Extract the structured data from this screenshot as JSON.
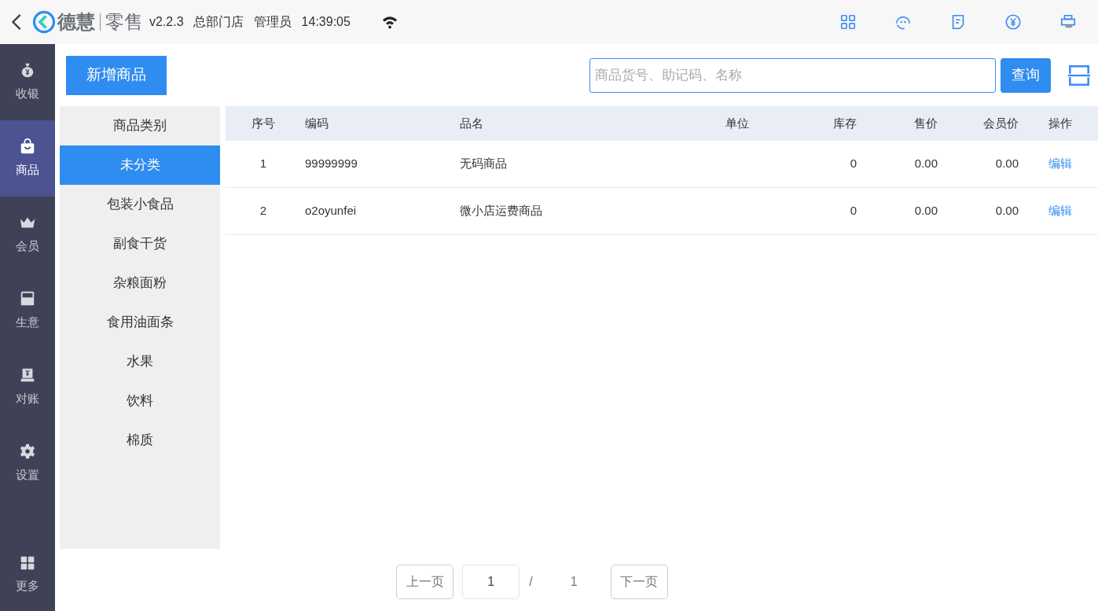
{
  "top_bar": {
    "brand": [
      "德慧",
      "零售"
    ],
    "version": "v2.2.3",
    "store": "总部门店",
    "user": "管理员",
    "time": "14:39:05"
  },
  "sidebar": {
    "items": [
      {
        "label": "收银",
        "selected": false
      },
      {
        "label": "商品",
        "selected": true
      },
      {
        "label": "会员",
        "selected": false
      },
      {
        "label": "生意",
        "selected": false
      },
      {
        "label": "对账",
        "selected": false
      },
      {
        "label": "设置",
        "selected": false
      }
    ],
    "more": "更多"
  },
  "new_button": "新增商品",
  "search": {
    "placeholder": "商品货号、助记码、名称",
    "button": "查询"
  },
  "categories_title": "商品类别",
  "categories": [
    {
      "label": "未分类",
      "selected": true
    },
    {
      "label": "包装小食品",
      "selected": false
    },
    {
      "label": "副食干货",
      "selected": false
    },
    {
      "label": "杂粮面粉",
      "selected": false
    },
    {
      "label": "食用油面条",
      "selected": false
    },
    {
      "label": "水果",
      "selected": false
    },
    {
      "label": "饮料",
      "selected": false
    },
    {
      "label": "棉质",
      "selected": false
    }
  ],
  "table": {
    "columns": [
      "序号",
      "编码",
      "品名",
      "单位",
      "库存",
      "售价",
      "会员价",
      "操作"
    ],
    "rows": [
      [
        "1",
        "99999999",
        "无码商品",
        "",
        "0",
        "0.00",
        "0.00",
        "编辑"
      ],
      [
        "2",
        "o2oyunfei",
        "微小店运费商品",
        "",
        "0",
        "0.00",
        "0.00",
        "编辑"
      ]
    ]
  },
  "pagination": {
    "prev": "上一页",
    "page": "1",
    "separator": "/",
    "total": "1",
    "next": "下一页"
  }
}
